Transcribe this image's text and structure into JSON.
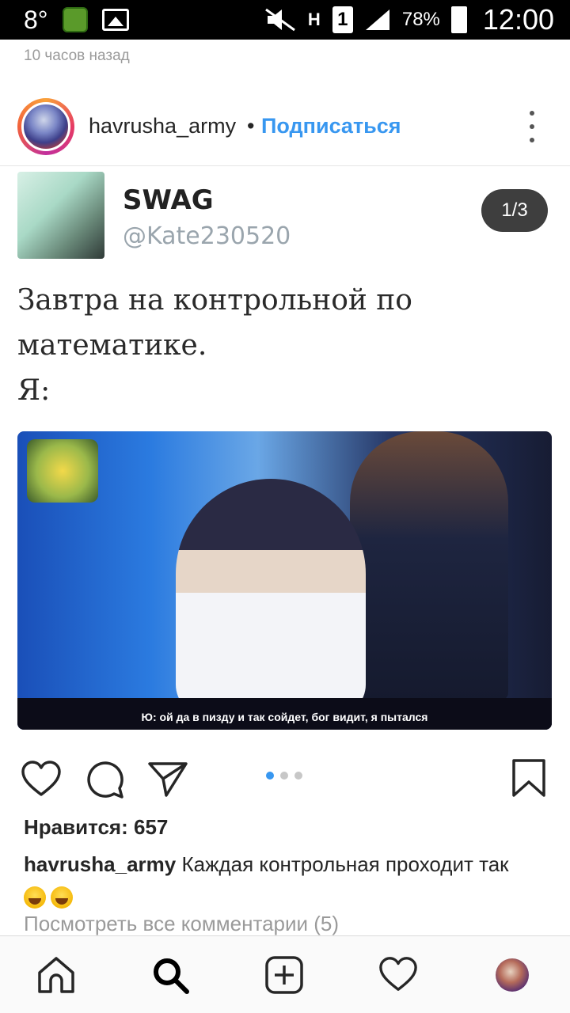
{
  "status_bar": {
    "temperature": "8°",
    "battery_percent": "78%",
    "time": "12:00",
    "network_label": "H",
    "sim_label": "1"
  },
  "post": {
    "time_ago": "10 часов назад",
    "username": "havrusha_army",
    "separator": "•",
    "follow_label": "Подписаться",
    "media_counter": "1/3",
    "tweet": {
      "name": "SWAG",
      "handle": "@Kate230520",
      "lines": [
        "Завтра на контрольной по",
        "математике.",
        "Я:"
      ]
    },
    "video_subtitle": "Ю: ой да в пизду и так сойдет, бог видит, я пытался",
    "carousel": {
      "count": 3,
      "active_index": 0
    },
    "likes_text": "Нравится: 657",
    "caption": {
      "username": "havrusha_army",
      "text": "Каждая контрольная проходит так"
    },
    "view_comments": "Посмотреть все комментарии (5)"
  },
  "icons": {
    "more": "more-vertical-icon",
    "like": "heart-icon",
    "comment": "comment-icon",
    "share": "send-icon",
    "save": "bookmark-icon",
    "nav": [
      "home-icon",
      "search-icon",
      "add-post-icon",
      "activity-heart-icon",
      "profile-avatar"
    ]
  },
  "colors": {
    "accent": "#3897f0",
    "text": "#262626",
    "muted": "#9a9a9a"
  }
}
